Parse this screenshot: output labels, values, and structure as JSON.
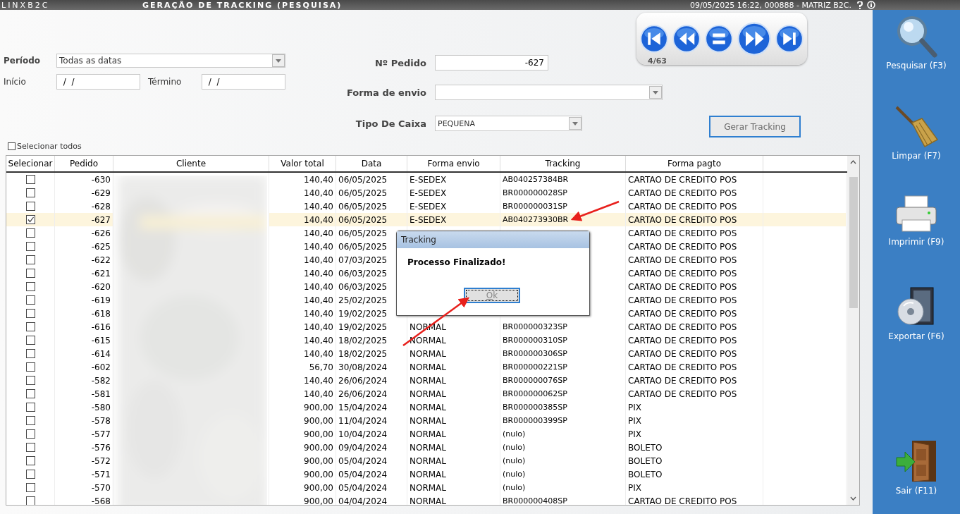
{
  "title_bar": {
    "app_name": "LINXB2C",
    "title": "GERAÇÃO DE TRACKING (PESQUISA)",
    "session": "09/05/2025 16:22, 000888 - MATRIZ B2C."
  },
  "navigator": {
    "position": "4/63"
  },
  "filters": {
    "periodo_label": "Período",
    "periodo_value": "Todas as datas",
    "inicio_label": "Início",
    "inicio_value": " /  /",
    "termino_label": "Término",
    "termino_value": " /  /",
    "pedido_label": "Nº Pedido",
    "pedido_value": "-627",
    "envio_label": "Forma de envio",
    "caixa_label": "Tipo De Caixa",
    "caixa_value": "PEQUENA",
    "select_all_label": "Selecionar todos",
    "select_all_checked": false,
    "generate_button": "Gerar Tracking"
  },
  "table": {
    "columns": [
      "Selecionar",
      "Pedido",
      "Cliente",
      "Valor total",
      "Data",
      "Forma envio",
      "Tracking",
      "Forma pagto"
    ],
    "rows": [
      {
        "checked": false,
        "selected": false,
        "pedido": "-630",
        "valor": "140,40",
        "data": "06/05/2025",
        "envio": "E-SEDEX",
        "tracking": "AB040257384BR",
        "pagto": "CARTAO DE CREDITO POS"
      },
      {
        "checked": false,
        "selected": false,
        "pedido": "-629",
        "valor": "140,40",
        "data": "06/05/2025",
        "envio": "E-SEDEX",
        "tracking": "BR000000028SP",
        "pagto": "CARTAO DE CREDITO POS"
      },
      {
        "checked": false,
        "selected": false,
        "pedido": "-628",
        "valor": "140,40",
        "data": "06/05/2025",
        "envio": "E-SEDEX",
        "tracking": "BR000000031SP",
        "pagto": "CARTAO DE CREDITO POS"
      },
      {
        "checked": true,
        "selected": true,
        "pedido": "-627",
        "valor": "140,40",
        "data": "06/05/2025",
        "envio": "E-SEDEX",
        "tracking": "AB040273930BR",
        "pagto": "CARTAO DE CREDITO POS"
      },
      {
        "checked": false,
        "selected": false,
        "pedido": "-626",
        "valor": "140,40",
        "data": "06/05/2025",
        "pagto": "CARTAO DE CREDITO POS"
      },
      {
        "checked": false,
        "selected": false,
        "pedido": "-625",
        "valor": "140,40",
        "data": "06/05/2025",
        "pagto": "CARTAO DE CREDITO POS"
      },
      {
        "checked": false,
        "selected": false,
        "pedido": "-622",
        "valor": "140,40",
        "data": "07/03/2025",
        "pagto": "CARTAO DE CREDITO POS"
      },
      {
        "checked": false,
        "selected": false,
        "pedido": "-621",
        "valor": "140,40",
        "data": "06/03/2025",
        "pagto": "CARTAO DE CREDITO POS"
      },
      {
        "checked": false,
        "selected": false,
        "pedido": "-620",
        "valor": "140,40",
        "data": "06/03/2025",
        "pagto": "CARTAO DE CREDITO POS"
      },
      {
        "checked": false,
        "selected": false,
        "pedido": "-619",
        "valor": "140,40",
        "data": "25/02/2025",
        "pagto": "CARTAO DE CREDITO POS"
      },
      {
        "checked": false,
        "selected": false,
        "pedido": "-618",
        "valor": "140,40",
        "data": "19/02/2025",
        "pagto": "CARTAO DE CREDITO POS"
      },
      {
        "checked": false,
        "selected": false,
        "pedido": "-616",
        "valor": "140,40",
        "data": "19/02/2025",
        "envio": "NORMAL",
        "tracking": "BR000000323SP",
        "pagto": "CARTAO DE CREDITO POS"
      },
      {
        "checked": false,
        "selected": false,
        "pedido": "-615",
        "valor": "140,40",
        "data": "18/02/2025",
        "envio": "NORMAL",
        "tracking": "BR000000310SP",
        "pagto": "CARTAO DE CREDITO POS"
      },
      {
        "checked": false,
        "selected": false,
        "pedido": "-614",
        "valor": "140,40",
        "data": "18/02/2025",
        "envio": "NORMAL",
        "tracking": "BR000000306SP",
        "pagto": "CARTAO DE CREDITO POS"
      },
      {
        "checked": false,
        "selected": false,
        "pedido": "-602",
        "valor": "56,70",
        "data": "30/08/2024",
        "envio": "NORMAL",
        "tracking": "BR000000221SP",
        "pagto": "CARTAO DE CREDITO POS"
      },
      {
        "checked": false,
        "selected": false,
        "pedido": "-582",
        "valor": "140,40",
        "data": "26/06/2024",
        "envio": "NORMAL",
        "tracking": "BR000000076SP",
        "pagto": "CARTAO DE CREDITO POS"
      },
      {
        "checked": false,
        "selected": false,
        "pedido": "-581",
        "valor": "140,40",
        "data": "26/06/2024",
        "envio": "NORMAL",
        "tracking": "BR000000062SP",
        "pagto": "CARTAO DE CREDITO POS"
      },
      {
        "checked": false,
        "selected": false,
        "pedido": "-580",
        "valor": "900,00",
        "data": "15/04/2024",
        "envio": "NORMAL",
        "tracking": "BR000000385SP",
        "pagto": "PIX"
      },
      {
        "checked": false,
        "selected": false,
        "pedido": "-578",
        "valor": "900,00",
        "data": "11/04/2024",
        "envio": "NORMAL",
        "tracking": "BR000000399SP",
        "pagto": "PIX"
      },
      {
        "checked": false,
        "selected": false,
        "pedido": "-577",
        "valor": "900,00",
        "data": "10/04/2024",
        "envio": "NORMAL",
        "tracking": "(nulo)",
        "pagto": "PIX"
      },
      {
        "checked": false,
        "selected": false,
        "pedido": "-576",
        "valor": "900,00",
        "data": "09/04/2024",
        "envio": "NORMAL",
        "tracking": "(nulo)",
        "pagto": "BOLETO"
      },
      {
        "checked": false,
        "selected": false,
        "pedido": "-572",
        "valor": "900,00",
        "data": "05/04/2024",
        "envio": "NORMAL",
        "tracking": "(nulo)",
        "pagto": "BOLETO"
      },
      {
        "checked": false,
        "selected": false,
        "pedido": "-571",
        "valor": "900,00",
        "data": "05/04/2024",
        "envio": "NORMAL",
        "tracking": "(nulo)",
        "pagto": "BOLETO"
      },
      {
        "checked": false,
        "selected": false,
        "pedido": "-570",
        "valor": "900,00",
        "data": "05/04/2024",
        "envio": "NORMAL",
        "tracking": "(nulo)",
        "pagto": "PIX"
      },
      {
        "checked": false,
        "selected": false,
        "pedido": "-568",
        "valor": "900,00",
        "data": "04/04/2024",
        "envio": "NORMAL",
        "tracking": "BR000000408SP",
        "pagto": "CARTAO DE CREDITO POS"
      }
    ]
  },
  "dialog": {
    "title": "Tracking",
    "message": "Processo Finalizado!",
    "button": "Ok"
  },
  "sidebar": {
    "buttons": [
      {
        "label": "Pesquisar (F3)"
      },
      {
        "label": "Limpar (F7)"
      },
      {
        "label": "Imprimir (F9)"
      },
      {
        "label": "Exportar (F6)"
      },
      {
        "label": "Sair (F11)"
      }
    ]
  }
}
